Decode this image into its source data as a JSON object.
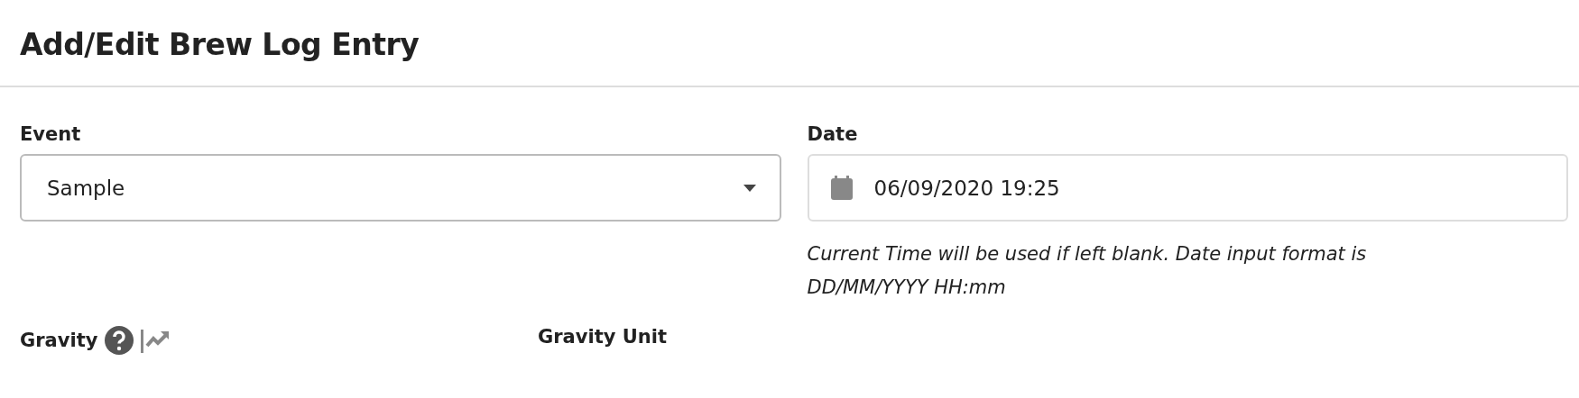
{
  "title": "Add/Edit Brew Log Entry",
  "event": {
    "label": "Event",
    "value": "Sample"
  },
  "date": {
    "label": "Date",
    "value": "06/09/2020 19:25",
    "help": "Current Time will be used if left blank. Date input format is DD/MM/YYYY HH:mm"
  },
  "gravity": {
    "label": "Gravity"
  },
  "gravity_unit": {
    "label": "Gravity Unit"
  }
}
